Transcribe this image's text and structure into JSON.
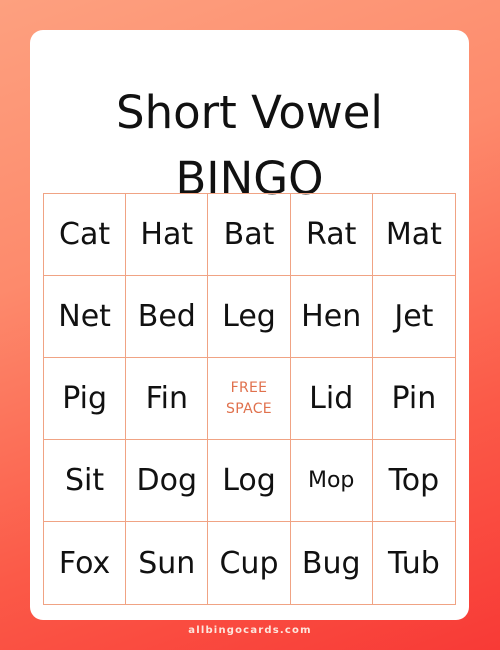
{
  "title_line1": "Short Vowel",
  "title_line2": "BINGO",
  "grid": [
    [
      "Cat",
      "Hat",
      "Bat",
      "Rat",
      "Mat"
    ],
    [
      "Net",
      "Bed",
      "Leg",
      "Hen",
      "Jet"
    ],
    [
      "Pig",
      "Fin",
      "FREE SPACE",
      "Lid",
      "Pin"
    ],
    [
      "Sit",
      "Dog",
      "Log",
      "Mop",
      "Top"
    ],
    [
      "Fox",
      "Sun",
      "Cup",
      "Bug",
      "Tub"
    ]
  ],
  "free_space": {
    "line1": "FREE",
    "line2": "SPACE"
  },
  "footer": "allbingocards.com",
  "colors": {
    "accent": "#e0714d",
    "grid_line": "#f0a384",
    "bg_top": "#fda07f",
    "bg_bottom": "#f83a36"
  }
}
